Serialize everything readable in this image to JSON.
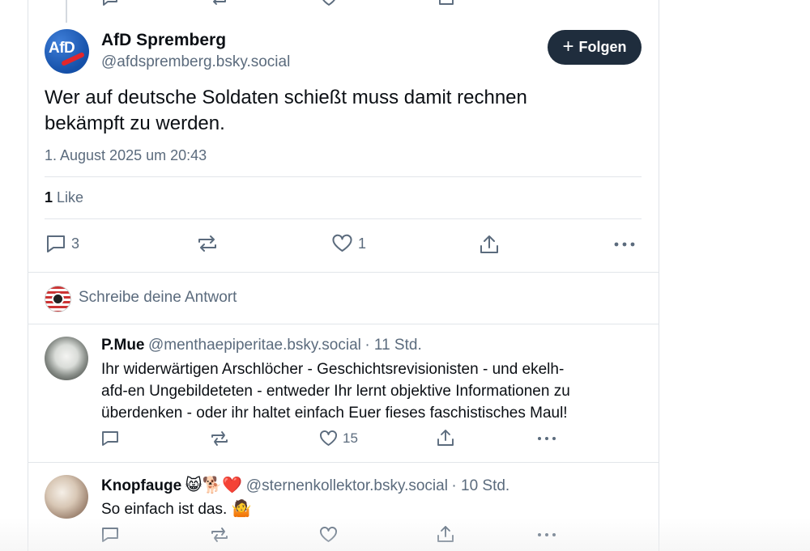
{
  "main_post": {
    "author_name": "AfD Spremberg",
    "author_handle": "@afdspremberg.bsky.social",
    "avatar_text": "AfD",
    "follow_label": "Folgen",
    "text_line1": "Wer auf deutsche Soldaten schießt muss damit rechnen",
    "text_line2": "bekämpft zu werden.",
    "timestamp": "1. August 2025 um 20:43",
    "likes_count": "1",
    "likes_label": "Like",
    "actions": {
      "reply_count": "3",
      "repost_count": "",
      "like_count": "1"
    }
  },
  "compose": {
    "placeholder": "Schreibe deine Antwort"
  },
  "replies": [
    {
      "name": "P.Mue",
      "handle": "@menthaepiperitae.bsky.social",
      "time": "· 11 Std.",
      "line1": "Ihr widerwärtigen Arschlöcher - Geschichtsrevisionisten - und ekelh-",
      "line2": "afd-en Ungebildeteten - entweder Ihr lernt objektive Informationen zu",
      "line3": "überdenken - oder ihr haltet einfach Euer fieses faschistisches Maul!",
      "like_count": "15"
    },
    {
      "name": "Knopfauge",
      "name_emoji": "😸🐕❤️",
      "handle": "@sternenkollektor.bsky.social",
      "time": "· 10 Std.",
      "line1": "So einfach ist das.",
      "line1_emoji": "🤷",
      "like_count": ""
    }
  ],
  "colors": {
    "follow_button_bg": "#1f2d3d",
    "secondary_text": "#5b6b7d",
    "divider": "#e2e6ea",
    "afd_blue": "#1550a8",
    "afd_red": "#e3262b"
  }
}
